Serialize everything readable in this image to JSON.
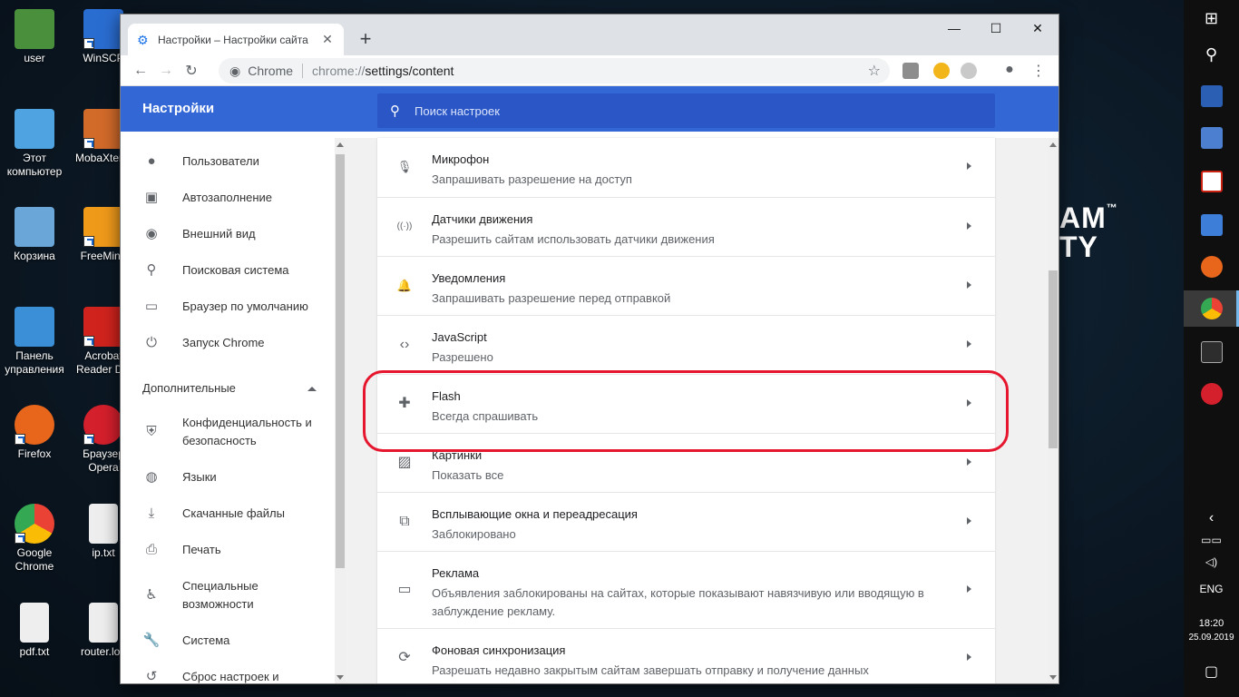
{
  "desktop": {
    "icons": [
      {
        "label": "user",
        "color": "#4a8f3c"
      },
      {
        "label": "WinSCP",
        "color": "#2a6dd1"
      },
      {
        "label": "Этот компьютер",
        "color": "#4ea3e0"
      },
      {
        "label": "MobaXterm",
        "color": "#d26a2a"
      },
      {
        "label": "Корзина",
        "color": "#6aa6d8"
      },
      {
        "label": "FreeMind",
        "color": "#f09a1a"
      },
      {
        "label": "Панель управления",
        "color": "#3b8fd6"
      },
      {
        "label": "Acrobat Reader DC",
        "color": "#d1231d"
      },
      {
        "label": "Firefox",
        "color": "#e8661b"
      },
      {
        "label": "Браузер Opera",
        "color": "#d41f2c"
      },
      {
        "label": "Google Chrome",
        "color": "#2fa54f"
      },
      {
        "label": "ip.txt",
        "color": "#eeeeee"
      },
      {
        "label": "pdf.txt",
        "color": "#eeeeee"
      },
      {
        "label": "router.log",
        "color": "#eeeeee"
      }
    ],
    "brand_line1": "AM",
    "brand_tm": "™",
    "brand_line2": "TY"
  },
  "window": {
    "tab_title": "Настройки – Настройки сайта",
    "tab_close": "✕",
    "new_tab": "+",
    "minimize": "—",
    "maximize": "☐",
    "close": "✕"
  },
  "toolbar": {
    "back": "←",
    "forward": "→",
    "reload": "↻",
    "site_label": "Chrome",
    "url_scheme": "chrome://",
    "url_path": "settings/content",
    "star": "☆",
    "profile": "●",
    "menu": "⋮"
  },
  "header": {
    "title": "Настройки",
    "search_placeholder": "Поиск настроек"
  },
  "sidebar": {
    "items": [
      {
        "label": "Пользователи",
        "icon": "person-icon",
        "glyph": "●"
      },
      {
        "label": "Автозаполнение",
        "icon": "clipboard-icon",
        "glyph": "▣"
      },
      {
        "label": "Внешний вид",
        "icon": "palette-icon",
        "glyph": "◉"
      },
      {
        "label": "Поисковая система",
        "icon": "search-icon",
        "glyph": "⚲"
      },
      {
        "label": "Браузер по умолчанию",
        "icon": "browser-icon",
        "glyph": "▭"
      },
      {
        "label": "Запуск Chrome",
        "icon": "power-icon",
        "glyph": "⏻"
      }
    ],
    "group_label": "Дополнительные",
    "advanced": [
      {
        "label": "Конфиденциальность и безопасность",
        "icon": "shield-icon",
        "glyph": "⛨"
      },
      {
        "label": "Языки",
        "icon": "globe-icon",
        "glyph": "◍"
      },
      {
        "label": "Скачанные файлы",
        "icon": "download-icon",
        "glyph": "⤓"
      },
      {
        "label": "Печать",
        "icon": "printer-icon",
        "glyph": "⎙"
      },
      {
        "label": "Специальные возможности",
        "icon": "accessibility-icon",
        "glyph": "♿"
      },
      {
        "label": "Система",
        "icon": "wrench-icon",
        "glyph": "🔧"
      },
      {
        "label": "Сброс настроек и",
        "icon": "reset-icon",
        "glyph": "↺"
      }
    ]
  },
  "settings": [
    {
      "title": "Микрофон",
      "subtitle": "Запрашивать разрешение на доступ",
      "icon": "microphone-icon",
      "glyph": "🎙"
    },
    {
      "title": "Датчики движения",
      "subtitle": "Разрешить сайтам использовать датчики движения",
      "icon": "sensors-icon",
      "glyph": "((·))"
    },
    {
      "title": "Уведомления",
      "subtitle": "Запрашивать разрешение перед отправкой",
      "icon": "bell-icon",
      "glyph": "🔔"
    },
    {
      "title": "JavaScript",
      "subtitle": "Разрешено",
      "icon": "code-icon",
      "glyph": "‹›"
    },
    {
      "title": "Flash",
      "subtitle": "Всегда спрашивать",
      "icon": "puzzle-icon",
      "glyph": "✚"
    },
    {
      "title": "Картинки",
      "subtitle": "Показать все",
      "icon": "image-icon",
      "glyph": "▨"
    },
    {
      "title": "Всплывающие окна и переадресация",
      "subtitle": "Заблокировано",
      "icon": "popup-icon",
      "glyph": "⧉"
    },
    {
      "title": "Реклама",
      "subtitle": "Объявления заблокированы на сайтах, которые показывают навязчивую или вводящую в заблуждение рекламу.",
      "icon": "ads-icon",
      "glyph": "▭"
    },
    {
      "title": "Фоновая синхронизация",
      "subtitle": "Разрешать недавно закрытым сайтам завершать отправку и получение данных",
      "icon": "sync-icon",
      "glyph": "⟳"
    }
  ],
  "taskbar": {
    "lang": "ENG",
    "time": "18:20",
    "date": "25.09.2019"
  },
  "colors": {
    "header": "#3367d6",
    "highlight": "#e5162d",
    "accent": "#1a73e8"
  }
}
